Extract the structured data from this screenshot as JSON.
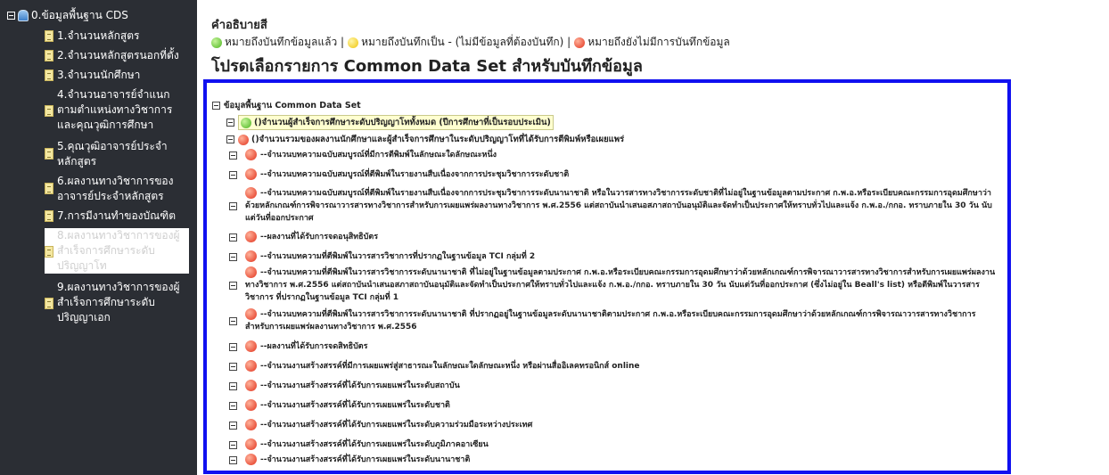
{
  "sidebar": {
    "root_label": "0.ข้อมูลพื้นฐาน CDS",
    "items": [
      {
        "label": "1.จำนวนหลักสูตร"
      },
      {
        "label": "2.จำนวนหลักสูตรนอกที่ตั้ง"
      },
      {
        "label": "3.จำนวนนักศึกษา"
      },
      {
        "label": "4.จำนวนอาจารย์จำแนกตามตำแหน่งทางวิชาการและคุณวุฒิการศึกษา"
      },
      {
        "label": "5.คุณวุฒิอาจารย์ประจำหลักสูตร"
      },
      {
        "label": "6.ผลงานทางวิชาการของอาจารย์ประจำหลักสูตร"
      },
      {
        "label": "7.การมีงานทำของบัณฑิต"
      },
      {
        "label": "8.ผลงานทางวิชาการของผู้สำเร็จการศึกษาระดับปริญญาโท"
      },
      {
        "label": "9.ผลงานทางวิชาการของผู้สำเร็จการศึกษาระดับปริญญาเอก"
      }
    ]
  },
  "main": {
    "legend_title": "คำอธิบายสี",
    "legend": {
      "green_text": "หมายถึงบันทึกข้อมูลแล้ว |",
      "yellow_text": "หมายถึงบันทึกเป็น - (ไม่มีข้อมูลที่ต้องบันทึก) |",
      "red_text": "หมายถึงยังไม่มีการบันทึกข้อมูล"
    },
    "title": "โปรดเลือกรายการ Common Data Set สำหรับบันทึกข้อมูล"
  },
  "tree": {
    "root_label": "ข้อมูลพื้นฐาน Common Data Set",
    "node1_label": "()จำนวนผู้สำเร็จการศึกษาระดับปริญญาโททั้งหมด (ปีการศึกษาที่เป็นรอบประเมิน)",
    "node2_label": "()จำนวนรวมของผลงานนักศึกษาและผู้สำเร็จการศึกษาในระดับปริญญาโทที่ได้รับการตีพิมพ์หรือเผยแพร่",
    "leaves": [
      {
        "label": "--จำนวนบทความฉบับสมบูรณ์ที่มีการตีพิมพ์ในลักษณะใดลักษณะหนึ่ง"
      },
      {
        "label": "--จำนวนบทความฉบับสมบูรณ์ที่ตีพิมพ์ในรายงานสืบเนื่องจากการประชุมวิชาการระดับชาติ"
      },
      {
        "label": "--จำนวนบทความฉบับสมบูรณ์ที่ตีพิมพ์ในรายงานสืบเนื่องจากการประชุมวิชาการระดับนานาชาติ หรือในวารสารทางวิชาการระดับชาติที่ไม่อยู่ในฐานข้อมูลตามประกาศ ก.พ.อ.หรือระเบียบคณะกรรมการอุดมศึกษาว่าด้วยหลักเกณฑ์การพิจารณาวารสารทางวิชาการสำหรับการเผยแพร่ผลงานทางวิชาการ พ.ศ.2556 แต่สถาบันนำเสนอสภาสถาบันอนุมัติและจัดทำเป็นประกาศให้ทราบทั่วไปและแจ้ง ก.พ.อ./กกอ. ทราบภายใน 30 วัน นับแต่วันที่ออกประกาศ"
      },
      {
        "label": "--ผลงานที่ได้รับการจดอนุสิทธิบัตร"
      },
      {
        "label": "--จำนวนบทความที่ตีพิมพ์ในวารสารวิชาการที่ปรากฏในฐานข้อมูล TCI กลุ่มที่ 2"
      },
      {
        "label": "--จำนวนบทความที่ตีพิมพ์ในวารสารวิชาการระดับนานาชาติ ที่ไม่อยู่ในฐานข้อมูลตามประกาศ ก.พ.อ.หรือระเบียบคณะกรรมการอุดมศึกษาว่าด้วยหลักเกณฑ์การพิจารณาวารสารทางวิชาการสำหรับการเผยแพร่ผลงานทางวิชาการ พ.ศ.2556 แต่สถาบันนำเสนอสภาสถาบันอนุมัติและจัดทำเป็นประกาศให้ทราบทั่วไปและแจ้ง ก.พ.อ./กกอ. ทราบภายใน 30 วัน นับแต่วันที่ออกประกาศ (ซึ่งไม่อยู่ใน Beall's list) หรือตีพิมพ์ในวารสารวิชาการ ที่ปรากฏในฐานข้อมูล TCI กลุ่มที่ 1"
      },
      {
        "label": "--จำนวนบทความที่ตีพิมพ์ในวารสารวิชาการระดับนานาชาติ ที่ปรากฏอยู่ในฐานข้อมูลระดับนานาชาติตามประกาศ ก.พ.อ.หรือระเบียบคณะกรรมการอุดมศึกษาว่าด้วยหลักเกณฑ์การพิจารณาวารสารทางวิชาการสำหรับการเผยแพร่ผลงานทางวิชาการ พ.ศ.2556"
      },
      {
        "label": "--ผลงานที่ได้รับการจดสิทธิบัตร"
      },
      {
        "label": "--จำนวนงานสร้างสรรค์ที่มีการเผยแพร่สู่สาธารณะในลักษณะใดลักษณะหนึ่ง หรือผ่านสื่ออิเลคทรอนิกส์ online"
      },
      {
        "label": "--จำนวนงานสร้างสรรค์ที่ได้รับการเผยแพร่ในระดับสถาบัน"
      },
      {
        "label": "--จำนวนงานสร้างสรรค์ที่ได้รับการเผยแพร่ในระดับชาติ"
      },
      {
        "label": "--จำนวนงานสร้างสรรค์ที่ได้รับการเผยแพร่ในระดับความร่วมมือระหว่างประเทศ"
      },
      {
        "label": "--จำนวนงานสร้างสรรค์ที่ได้รับการเผยแพร่ในระดับภูมิภาคอาเซียน"
      },
      {
        "label": "--จำนวนงานสร้างสรรค์ที่ได้รับการเผยแพร่ในระดับนานาชาติ"
      }
    ]
  },
  "colors": {
    "sidebar_bg": "#2b2e34",
    "panel_border": "#1010f0",
    "status_red": "#e2321c",
    "status_green": "#4bb41e",
    "status_yellow": "#efc40a"
  }
}
